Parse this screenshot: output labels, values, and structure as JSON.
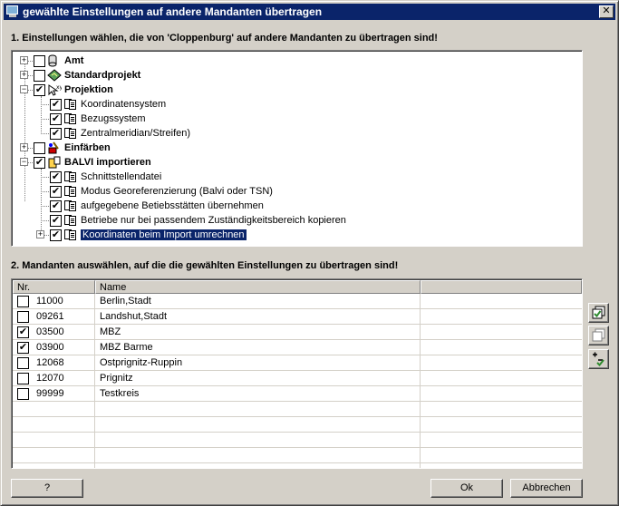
{
  "window": {
    "title": "gewählte Einstellungen auf andere Mandanten übertragen",
    "close_glyph": "✕"
  },
  "section1": {
    "label": "1. Einstellungen wählen, die von 'Cloppenburg' auf andere Mandanten zu übertragen sind!"
  },
  "tree": {
    "items": [
      {
        "label": "Amt",
        "level": 0,
        "bold": true,
        "checked": false,
        "expander": "+",
        "icon": "database-icon"
      },
      {
        "label": "Standardprojekt",
        "level": 0,
        "bold": true,
        "checked": false,
        "expander": "+",
        "icon": "map-icon"
      },
      {
        "label": "Projektion",
        "level": 0,
        "bold": true,
        "checked": true,
        "expander": "−",
        "icon": "projection-icon"
      },
      {
        "label": "Koordinatensystem",
        "level": 1,
        "bold": false,
        "checked": true,
        "expander": "",
        "icon": "document-icon"
      },
      {
        "label": "Bezugssystem",
        "level": 1,
        "bold": false,
        "checked": true,
        "expander": "",
        "icon": "document-icon"
      },
      {
        "label": "Zentralmeridian/Streifen)",
        "level": 1,
        "bold": false,
        "checked": true,
        "expander": "",
        "icon": "document-icon"
      },
      {
        "label": "Einfärben",
        "level": 0,
        "bold": true,
        "checked": false,
        "expander": "+",
        "icon": "paint-icon"
      },
      {
        "label": "BALVI importieren",
        "level": 0,
        "bold": true,
        "checked": true,
        "expander": "−",
        "icon": "import-icon"
      },
      {
        "label": "Schnittstellendatei",
        "level": 1,
        "bold": false,
        "checked": true,
        "expander": "",
        "icon": "document-icon"
      },
      {
        "label": "Modus Georeferenzierung (Balvi oder TSN)",
        "level": 1,
        "bold": false,
        "checked": true,
        "expander": "",
        "icon": "document-icon"
      },
      {
        "label": "aufgegebene Betiebsstätten übernehmen",
        "level": 1,
        "bold": false,
        "checked": true,
        "expander": "",
        "icon": "document-icon"
      },
      {
        "label": "Betriebe nur bei passendem Zuständigkeitsbereich kopieren",
        "level": 1,
        "bold": false,
        "checked": true,
        "expander": "",
        "icon": "document-icon"
      },
      {
        "label": "Koordinaten beim Import umrechnen",
        "level": 1,
        "bold": false,
        "checked": true,
        "expander": "+",
        "icon": "document-icon",
        "selected": true
      }
    ]
  },
  "section2": {
    "label": "2. Mandanten auswählen, auf die die gewählten Einstellungen zu übertragen sind!"
  },
  "grid": {
    "columns": [
      "Nr.",
      "Name",
      ""
    ],
    "rows": [
      {
        "nr": "11000",
        "name": "Berlin,Stadt",
        "checked": false
      },
      {
        "nr": "09261",
        "name": "Landshut,Stadt",
        "checked": false
      },
      {
        "nr": "03500",
        "name": "MBZ",
        "checked": true
      },
      {
        "nr": "03900",
        "name": "MBZ Barme",
        "checked": true
      },
      {
        "nr": "12068",
        "name": "Ostprignitz-Ruppin",
        "checked": false
      },
      {
        "nr": "12070",
        "name": "Prignitz",
        "checked": false
      },
      {
        "nr": "99999",
        "name": "Testkreis",
        "checked": false
      }
    ],
    "empty_rows": 5
  },
  "check_glyph": "✔",
  "buttons": {
    "help": "?",
    "ok": "Ok",
    "cancel": "Abbrechen"
  },
  "colors": {
    "title_bg": "#0a246a",
    "selection": "#0a246a",
    "face": "#d4d0c8",
    "check_green": "#2e8b2e"
  }
}
